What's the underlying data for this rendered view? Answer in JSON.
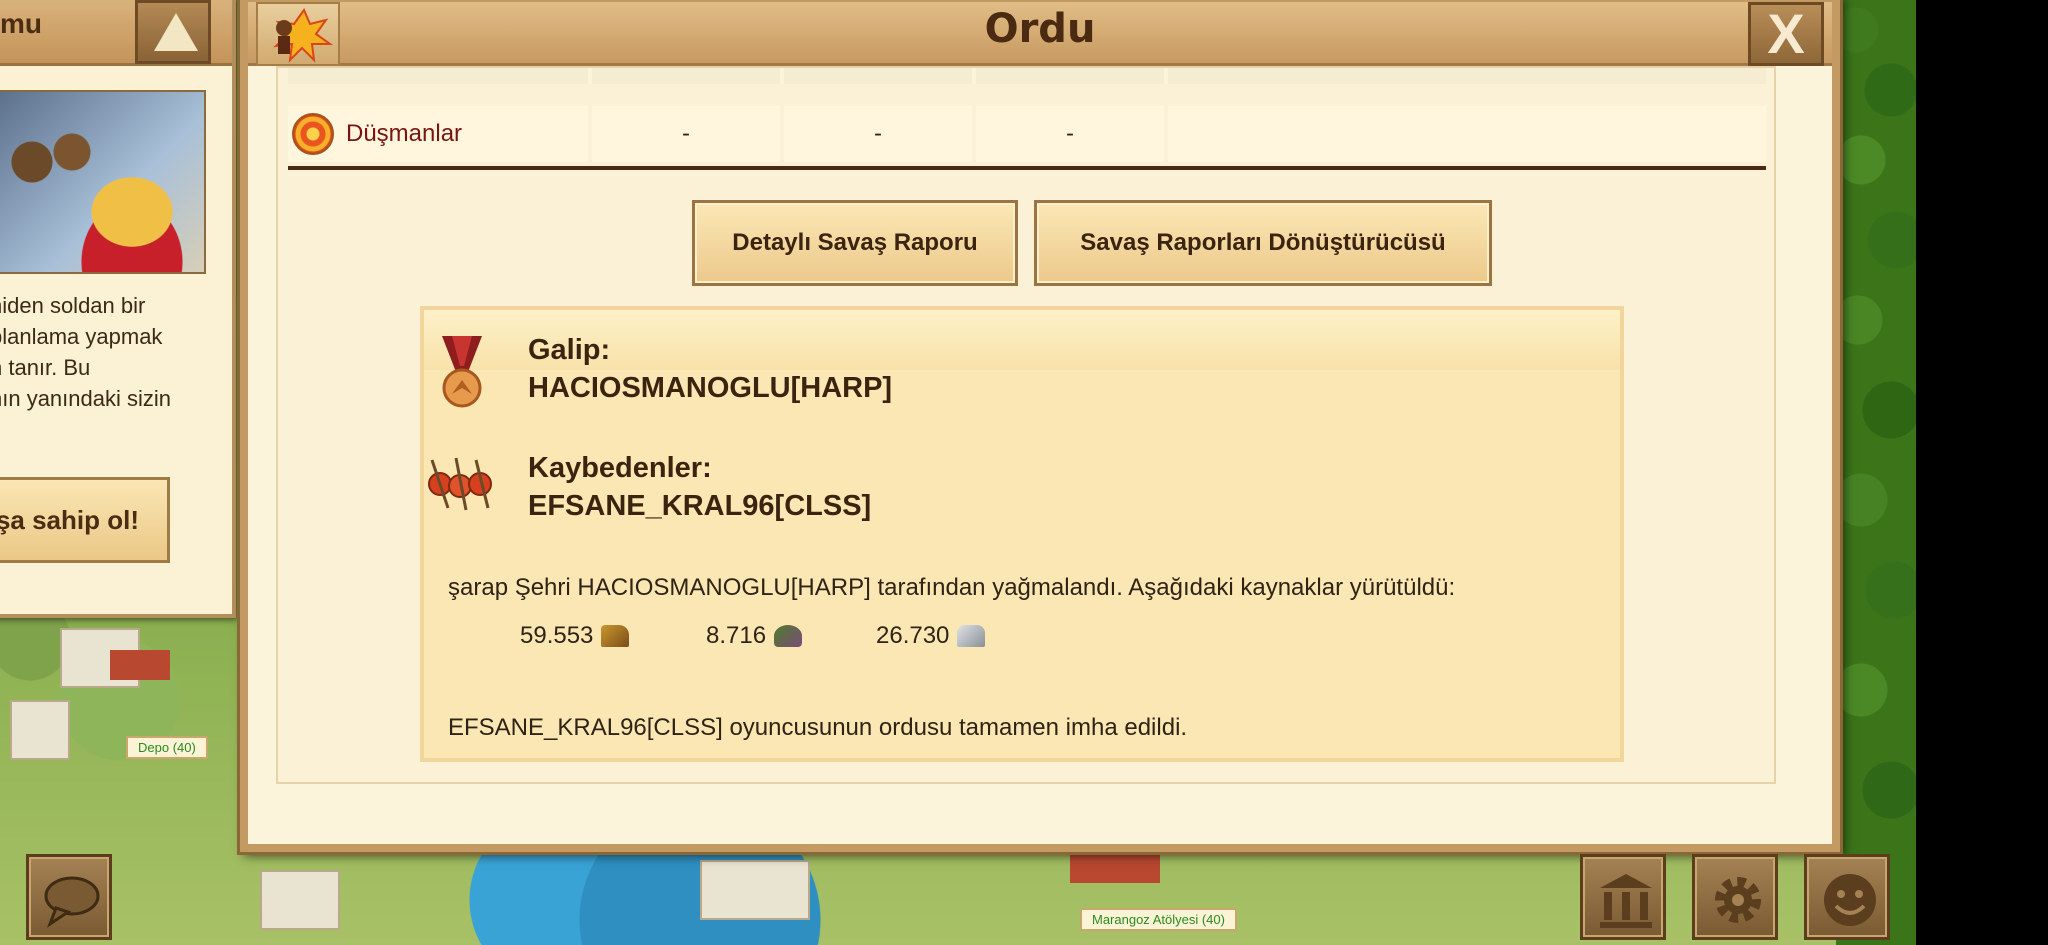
{
  "left_panel": {
    "title": "mu",
    "text_lines": [
      "niden soldan bir",
      "planlama yapmak",
      "n tanır. Bu",
      "nın yanındaki sizin"
    ],
    "button_label": "şa sahip ol!"
  },
  "map_labels": {
    "warehouse": "Depo (40)",
    "carpenter": "Marangoz Atölyesi (40)"
  },
  "dialog": {
    "title": "Ordu",
    "close_label": "X",
    "enemies_row": {
      "label": "Düşmanlar",
      "values": [
        "-",
        "-",
        "-"
      ]
    },
    "buttons": {
      "detailed_report": "Detaylı Savaş Raporu",
      "report_converter": "Savaş Raporları Dönüştürücüsü"
    },
    "result": {
      "winner_label": "Galip:",
      "winner_name": "HACIOSMANOGLU[HARP]",
      "losers_label": "Kaybedenler:",
      "loser_name": "EFSANE_KRAL96[CLSS]",
      "plunder_text": "şarap Şehri HACIOSMANOGLU[HARP] tarafından yağmalandı. Aşağıdaki kaynaklar yürütüldü:",
      "resources": [
        {
          "amount": "59.553",
          "icon": "wood-icon"
        },
        {
          "amount": "8.716",
          "icon": "stone-icon"
        },
        {
          "amount": "26.730",
          "icon": "silver-icon"
        }
      ],
      "destroyed_text": "EFSANE_KRAL96[CLSS] oyuncusunun ordusu tamamen imha edildi."
    }
  },
  "colors": {
    "dialog_border": "#c49a63",
    "header": "#c79a61",
    "result_bg": "#fbe7b3",
    "enemy_label": "#7a1414"
  }
}
